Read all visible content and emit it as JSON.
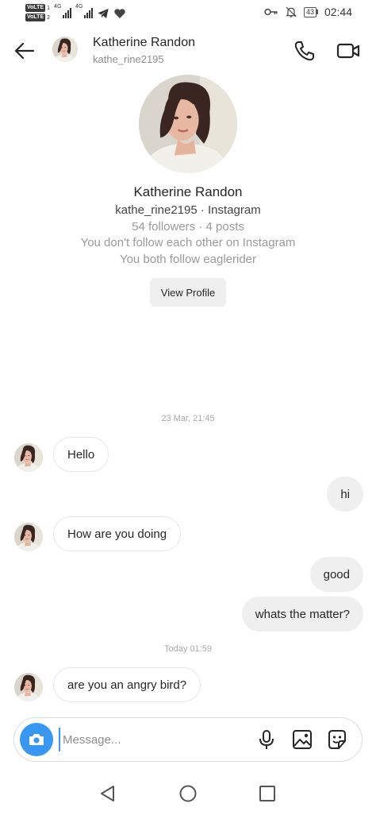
{
  "status_bar": {
    "volte_1": "VoLTE",
    "sim_1": "1",
    "volte_2": "VoLTE",
    "sim_2": "2",
    "net_1": "4G",
    "net_2": "4G",
    "battery_level": "43",
    "time": "02:44",
    "icons": [
      "signal-icon",
      "telegram-icon",
      "heart-icon",
      "key-icon",
      "mute-icon",
      "battery-icon"
    ]
  },
  "header": {
    "name": "Katherine Randon",
    "username": "kathe_rine2195",
    "icons": [
      "back-arrow-icon",
      "phone-icon",
      "video-camera-icon"
    ]
  },
  "profile": {
    "name": "Katherine Randon",
    "subtitle": "kathe_rine2195 · Instagram",
    "stats": "54 followers · 4 posts",
    "follow_status": "You don't follow each other on Instagram",
    "mutual": "You both follow eaglerider",
    "view_profile_label": "View Profile"
  },
  "messages": {
    "timestamp_1": "23 Mar, 21:45",
    "m1": "Hello",
    "m2": "hi",
    "m3": "How are you doing",
    "m4": "good",
    "m5": "whats the matter?",
    "timestamp_2": "Today 01:59",
    "m6": "are you an angry bird?"
  },
  "composer": {
    "placeholder": "Message...",
    "icons": [
      "camera-icon",
      "microphone-icon",
      "gallery-icon",
      "sticker-icon"
    ]
  },
  "nav_bar": {
    "icons": [
      "nav-back-icon",
      "nav-home-icon",
      "nav-recent-icon"
    ]
  },
  "colors": {
    "accent": "#3897f0",
    "text": "#262626",
    "secondary_text": "#8e8e8e",
    "outgoing_bubble": "#efefef"
  }
}
